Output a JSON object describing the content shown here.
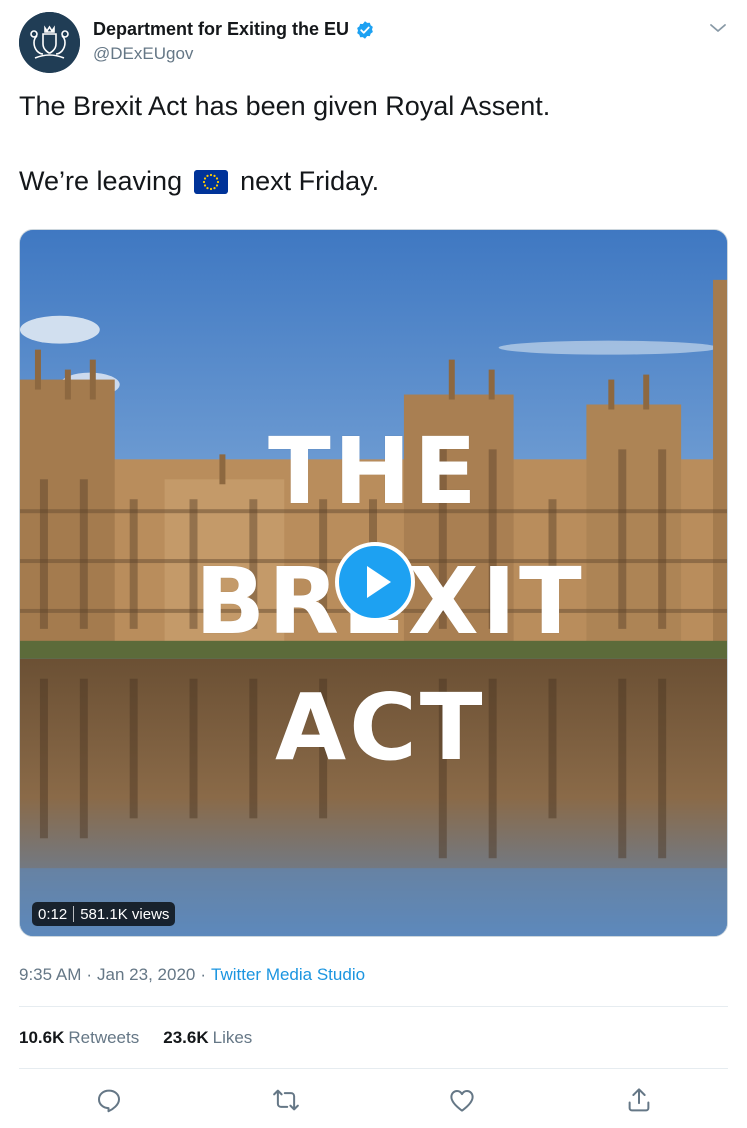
{
  "account": {
    "display_name": "Department for Exiting the EU",
    "handle": "@DExEUgov",
    "verified": true,
    "avatar_icon": "royal-coat-of-arms"
  },
  "tweet": {
    "line1": "The Brexit Act has been given Royal Assent.",
    "line2_before": "We’re leaving",
    "line2_emoji": "eu-flag",
    "line2_after": "next Friday."
  },
  "video": {
    "overlay_words": [
      "THE",
      "BREXIT",
      "ACT"
    ],
    "duration": "0:12",
    "views": "581.1K views"
  },
  "meta": {
    "time": "9:35 AM",
    "separator": "·",
    "date": "Jan 23, 2020",
    "source": "Twitter Media Studio"
  },
  "stats": {
    "retweets_count": "10.6K",
    "retweets_label": "Retweets",
    "likes_count": "23.6K",
    "likes_label": "Likes"
  },
  "actions": [
    "reply-icon",
    "retweet-icon",
    "like-icon",
    "share-icon"
  ],
  "colors": {
    "accent": "#1da1f2",
    "link": "#1b95e0",
    "muted": "#657786",
    "text": "#14171a"
  }
}
